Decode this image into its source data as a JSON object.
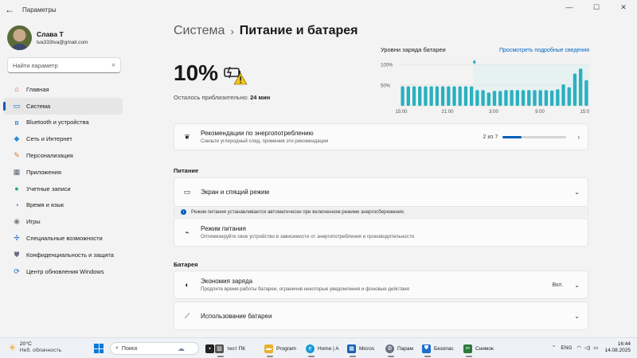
{
  "window": {
    "title": "Параметры",
    "back": "←",
    "minimize": "—",
    "maximize": "☐",
    "close": "✕"
  },
  "user": {
    "name": "Слава Т",
    "email": "tva333tva@gmail.com"
  },
  "search": {
    "placeholder": "Найти параметр"
  },
  "nav": [
    {
      "label": "Главная",
      "icon": "home-icon",
      "glyph": "⌂",
      "color": "#c85a2e"
    },
    {
      "label": "Система",
      "icon": "monitor-icon",
      "glyph": "▭",
      "color": "#0067c0",
      "active": true
    },
    {
      "label": "Bluetooth и устройства",
      "icon": "bluetooth-icon",
      "glyph": "ʙ",
      "color": "#0a6dd0"
    },
    {
      "label": "Сеть и Интернет",
      "icon": "wifi-diamond-icon",
      "glyph": "◆",
      "color": "#2b8ad8"
    },
    {
      "label": "Персонализация",
      "icon": "brush-icon",
      "glyph": "✎",
      "color": "#d27a30"
    },
    {
      "label": "Приложения",
      "icon": "apps-icon",
      "glyph": "▦",
      "color": "#5a6474"
    },
    {
      "label": "Учетные записи",
      "icon": "person-icon",
      "glyph": "●",
      "color": "#2aa26e"
    },
    {
      "label": "Время и язык",
      "icon": "globe-clock-icon",
      "glyph": "◔",
      "color": "#1a73c8"
    },
    {
      "label": "Игры",
      "icon": "gamepad-icon",
      "glyph": "◉",
      "color": "#7a7f88"
    },
    {
      "label": "Специальные возможности",
      "icon": "accessibility-icon",
      "glyph": "✢",
      "color": "#1a68c0"
    },
    {
      "label": "Конфиденциальность и защита",
      "icon": "shield-icon",
      "glyph": "⛊",
      "color": "#6a7080"
    },
    {
      "label": "Центр обновления Windows",
      "icon": "update-icon",
      "glyph": "⟳",
      "color": "#0a6fd0"
    }
  ],
  "breadcrumb": {
    "parent": "Система",
    "separator": "›",
    "current": "Питание и батарея"
  },
  "battery": {
    "percent": "10%",
    "remaining_label": "Осталось приблизительно:",
    "remaining_value": "24 мин"
  },
  "chart_data": {
    "type": "bar",
    "title": "Уровни заряда батареи",
    "link": "Просмотреть подробные сведения",
    "yticks": [
      "100%",
      "50%"
    ],
    "xticks": [
      "15:00",
      "21:00",
      "3:00",
      "9:00",
      "15:00"
    ],
    "ylim": [
      0,
      100
    ],
    "values": [
      47,
      47,
      47,
      47,
      47,
      47,
      47,
      47,
      47,
      47,
      47,
      47,
      47,
      38,
      38,
      32,
      36,
      36,
      38,
      38,
      38,
      38,
      38,
      38,
      38,
      38,
      37,
      40,
      52,
      45,
      78,
      90,
      62
    ],
    "accent": "#2bb0bf",
    "highlight_start_index": 13
  },
  "recommendations": {
    "title": "Рекомендации по энергопотреблению",
    "subtitle": "Снизьте углеродный след, применив эти рекомендации",
    "count": "2 из 7",
    "progress": 0.29
  },
  "section_power": "Питание",
  "screen_sleep": {
    "title": "Экран и спящий режим"
  },
  "info": {
    "text": "Режим питания устанавливается автоматически при включенном режиме энергосбережения.",
    "icon": "i"
  },
  "power_mode": {
    "title": "Режим питания",
    "subtitle": "Оптимизируйте свое устройство в зависимости от энергопотребления и производительности"
  },
  "section_battery": "Батарея",
  "battery_saver": {
    "title": "Экономия заряда",
    "subtitle": "Продлите время работы батареи, ограничив некоторые уведомления и фоновые действия",
    "state": "Вкл."
  },
  "battery_usage": {
    "title": "Использование батареи"
  },
  "taskbar": {
    "weather_temp": "20°C",
    "weather_cond": "Неб. облачность",
    "search_placeholder": "Поиск",
    "apps": [
      {
        "label": "тест ПК"
      },
      {
        "label": "Program"
      },
      {
        "label": "Home | A"
      },
      {
        "label": "Micros"
      },
      {
        "label": "Парам"
      },
      {
        "label": "Безопас"
      },
      {
        "label": "Снимок"
      }
    ],
    "lang": "ENG",
    "time": "16:44",
    "date": "14.08.2025"
  }
}
